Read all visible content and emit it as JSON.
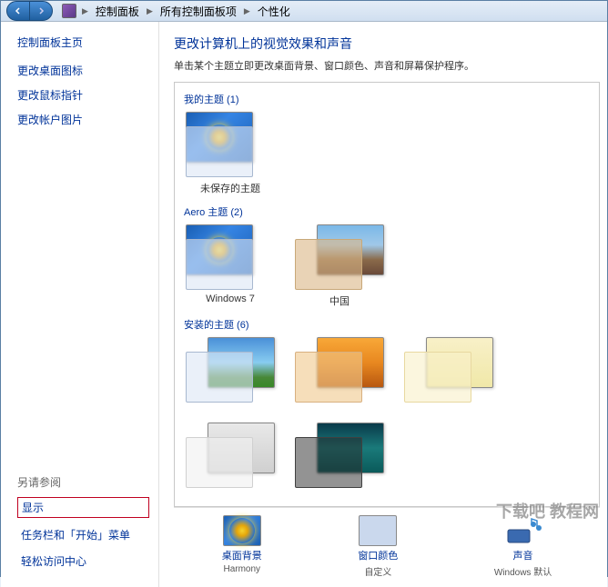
{
  "breadcrumb": {
    "item1": "控制面板",
    "item2": "所有控制面板项",
    "item3": "个性化"
  },
  "sidebar": {
    "title": "控制面板主页",
    "links": [
      "更改桌面图标",
      "更改鼠标指针",
      "更改帐户图片"
    ],
    "see_also_title": "另请参阅",
    "see_also_links": [
      "显示",
      "任务栏和「开始」菜单",
      "轻松访问中心"
    ]
  },
  "main": {
    "title": "更改计算机上的视觉效果和声音",
    "subtitle": "单击某个主题立即更改桌面背景、窗口颜色、声音和屏幕保护程序。",
    "sections": {
      "my_themes": {
        "label": "我的主题 (1)",
        "items": [
          "未保存的主题"
        ]
      },
      "aero_themes": {
        "label": "Aero 主题 (2)",
        "items": [
          "Windows 7",
          "中国"
        ]
      },
      "installed_themes": {
        "label": "安装的主题 (6)",
        "items": [
          "",
          "",
          "",
          "",
          ""
        ]
      }
    }
  },
  "bottom": {
    "bg": {
      "label": "桌面背景",
      "sub": "Harmony"
    },
    "color": {
      "label": "窗口颜色",
      "sub": "自定义"
    },
    "sound": {
      "label": "声音",
      "sub": "Windows 默认"
    }
  },
  "watermark": "下载吧 教程网"
}
